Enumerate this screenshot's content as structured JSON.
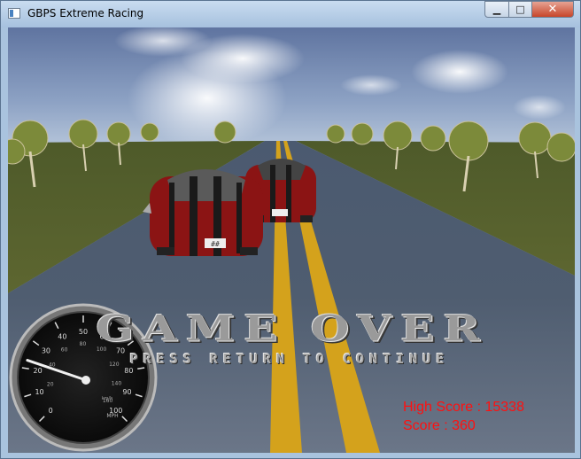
{
  "window": {
    "title": "GBPS Extreme Racing",
    "minimize_glyph": "▁",
    "maximize_glyph": "□",
    "close_glyph": "✕"
  },
  "game": {
    "game_over_text": "GAME OVER",
    "press_return_text": "PRESS RETURN TO CONTINUE",
    "high_score_text": "High Score : 15338",
    "score_text": "Score : 360",
    "high_score": 15338,
    "score": 360,
    "license_plate": "##"
  },
  "speedometer": {
    "mph_ticks": [
      "0",
      "10",
      "20",
      "30",
      "40",
      "50",
      "60",
      "70",
      "80",
      "90",
      "100"
    ],
    "kmh_ticks": [
      "20",
      "40",
      "60",
      "80",
      "100",
      "120",
      "140",
      "160"
    ],
    "unit_label": "MPH",
    "unit_label_small": "km/h",
    "speed_mph": 23,
    "max_mph": 100
  },
  "colors": {
    "score_text": "#ff1010",
    "car_body": "#8b1414",
    "road_line": "#d4a21c"
  }
}
